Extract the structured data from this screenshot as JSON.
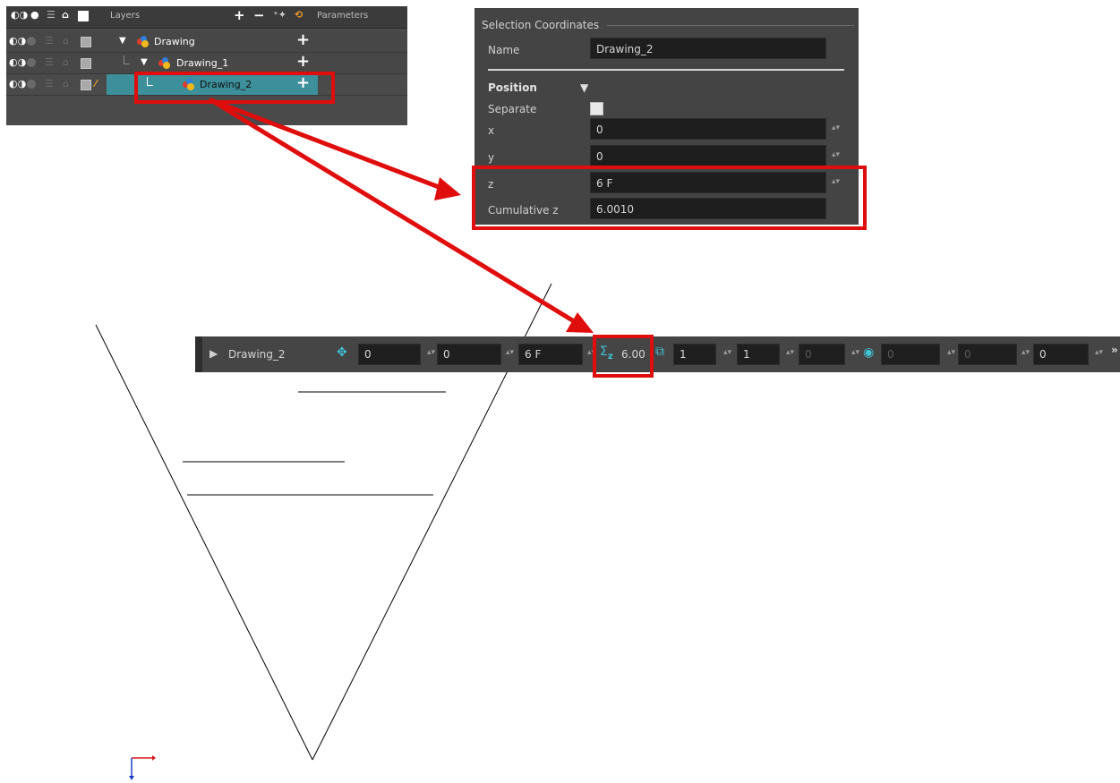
{
  "layers_panel": {
    "title": "Layers",
    "params_label": "Parameters",
    "rows": [
      {
        "name": "Drawing"
      },
      {
        "name": "Drawing_1"
      },
      {
        "name": "Drawing_2"
      }
    ]
  },
  "selection_panel": {
    "title": "Selection Coordinates",
    "name_label": "Name",
    "name_value": "Drawing_2",
    "position_label": "Position",
    "separate_label": "Separate",
    "x_label": "x",
    "x_value": "0",
    "y_label": "y",
    "y_value": "0",
    "z_label": "z",
    "z_value": "6 F",
    "cumz_label": "Cumulative z",
    "cumz_value": "6.0010"
  },
  "toolbar": {
    "layer_name": "Drawing_2",
    "pos_x": "0",
    "pos_y": "0",
    "pos_z": "6 F",
    "cumulative_z": "6.00",
    "scale_x": "1",
    "scale_y": "1",
    "scale_z": "0",
    "rotate_x": "0",
    "rotate_y": "0",
    "rotate_z": "0"
  },
  "icons": [
    "eye-icon",
    "dot-icon",
    "database-icon",
    "lock-icon",
    "color-square-icon",
    "pencil-icon",
    "move-icon",
    "sigma-icon",
    "scale-icon",
    "rotate-icon",
    "expand-icon",
    "add-layer-icon",
    "remove-layer-icon"
  ],
  "colors": {
    "highlight": "#e00d0d",
    "selection": "#3d8f9b",
    "accent": "#41c3d8"
  }
}
